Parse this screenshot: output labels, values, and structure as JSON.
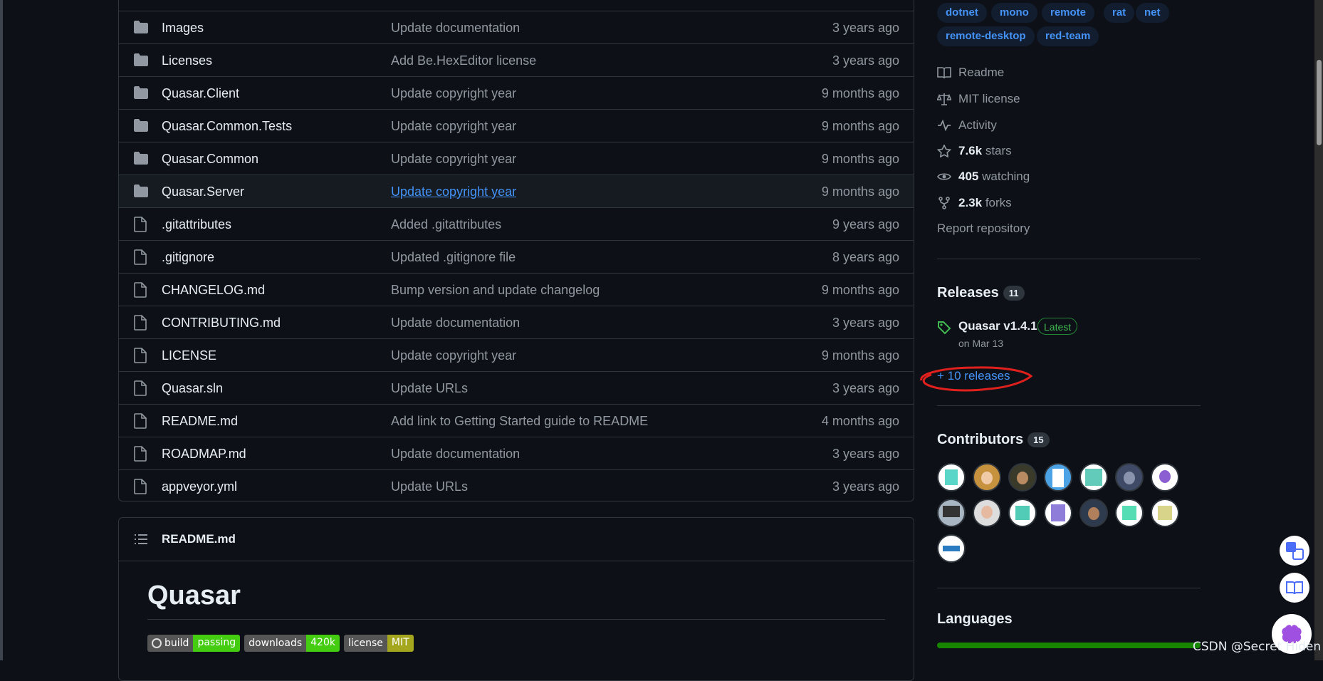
{
  "file_table": {
    "rows": [
      {
        "name": "Images",
        "type": "folder",
        "message": "Update documentation",
        "age": "3 years ago"
      },
      {
        "name": "Licenses",
        "type": "folder",
        "message": "Add Be.HexEditor license",
        "age": "3 years ago"
      },
      {
        "name": "Quasar.Client",
        "type": "folder",
        "message": "Update copyright year",
        "age": "9 months ago"
      },
      {
        "name": "Quasar.Common.Tests",
        "type": "folder",
        "message": "Update copyright year",
        "age": "9 months ago"
      },
      {
        "name": "Quasar.Common",
        "type": "folder",
        "message": "Update copyright year",
        "age": "9 months ago"
      },
      {
        "name": "Quasar.Server",
        "type": "folder",
        "message": "Update copyright year",
        "age": "9 months ago",
        "hovered": true
      },
      {
        "name": ".gitattributes",
        "type": "file",
        "message": "Added .gitattributes",
        "age": "9 years ago"
      },
      {
        "name": ".gitignore",
        "type": "file",
        "message": "Updated .gitignore file",
        "age": "8 years ago"
      },
      {
        "name": "CHANGELOG.md",
        "type": "file",
        "message": "Bump version and update changelog",
        "age": "9 months ago"
      },
      {
        "name": "CONTRIBUTING.md",
        "type": "file",
        "message": "Update documentation",
        "age": "3 years ago"
      },
      {
        "name": "LICENSE",
        "type": "file",
        "message": "Update copyright year",
        "age": "9 months ago"
      },
      {
        "name": "Quasar.sln",
        "type": "file",
        "message": "Update URLs",
        "age": "3 years ago"
      },
      {
        "name": "README.md",
        "type": "file",
        "message": "Add link to Getting Started guide to README",
        "age": "4 months ago"
      },
      {
        "name": "ROADMAP.md",
        "type": "file",
        "message": "Update documentation",
        "age": "3 years ago"
      },
      {
        "name": "appveyor.yml",
        "type": "file",
        "message": "Update URLs",
        "age": "3 years ago"
      }
    ]
  },
  "readme": {
    "header": "README.md",
    "title": "Quasar",
    "badges": [
      {
        "label": "build",
        "value": "passing",
        "color": "#4c1"
      },
      {
        "label": "downloads",
        "value": "420k",
        "color": "#4c1"
      },
      {
        "label": "license",
        "value": "MIT",
        "color": "#a4a61d"
      }
    ]
  },
  "sidebar": {
    "topics": [
      "dotnet",
      "mono",
      "remote",
      "rat",
      "net",
      "remote-desktop",
      "red-team"
    ],
    "meta": {
      "readme": "Readme",
      "license": "MIT license",
      "activity": "Activity",
      "stars_count": "7.6k",
      "stars_label": "stars",
      "watching_count": "405",
      "watching_label": "watching",
      "forks_count": "2.3k",
      "forks_label": "forks",
      "report": "Report repository"
    },
    "releases": {
      "heading": "Releases",
      "count": "11",
      "latest_name": "Quasar v1.4.1",
      "latest_badge": "Latest",
      "latest_date": "on Mar 13",
      "more": "+ 10 releases"
    },
    "contributors": {
      "heading": "Contributors",
      "count": "15"
    },
    "languages": {
      "heading": "Languages"
    }
  },
  "watermark": "CSDN @Secret Hiden",
  "colors": {
    "accent": "#4493f8",
    "annotation": "#e0201c",
    "latest_green": "#3fb950"
  }
}
